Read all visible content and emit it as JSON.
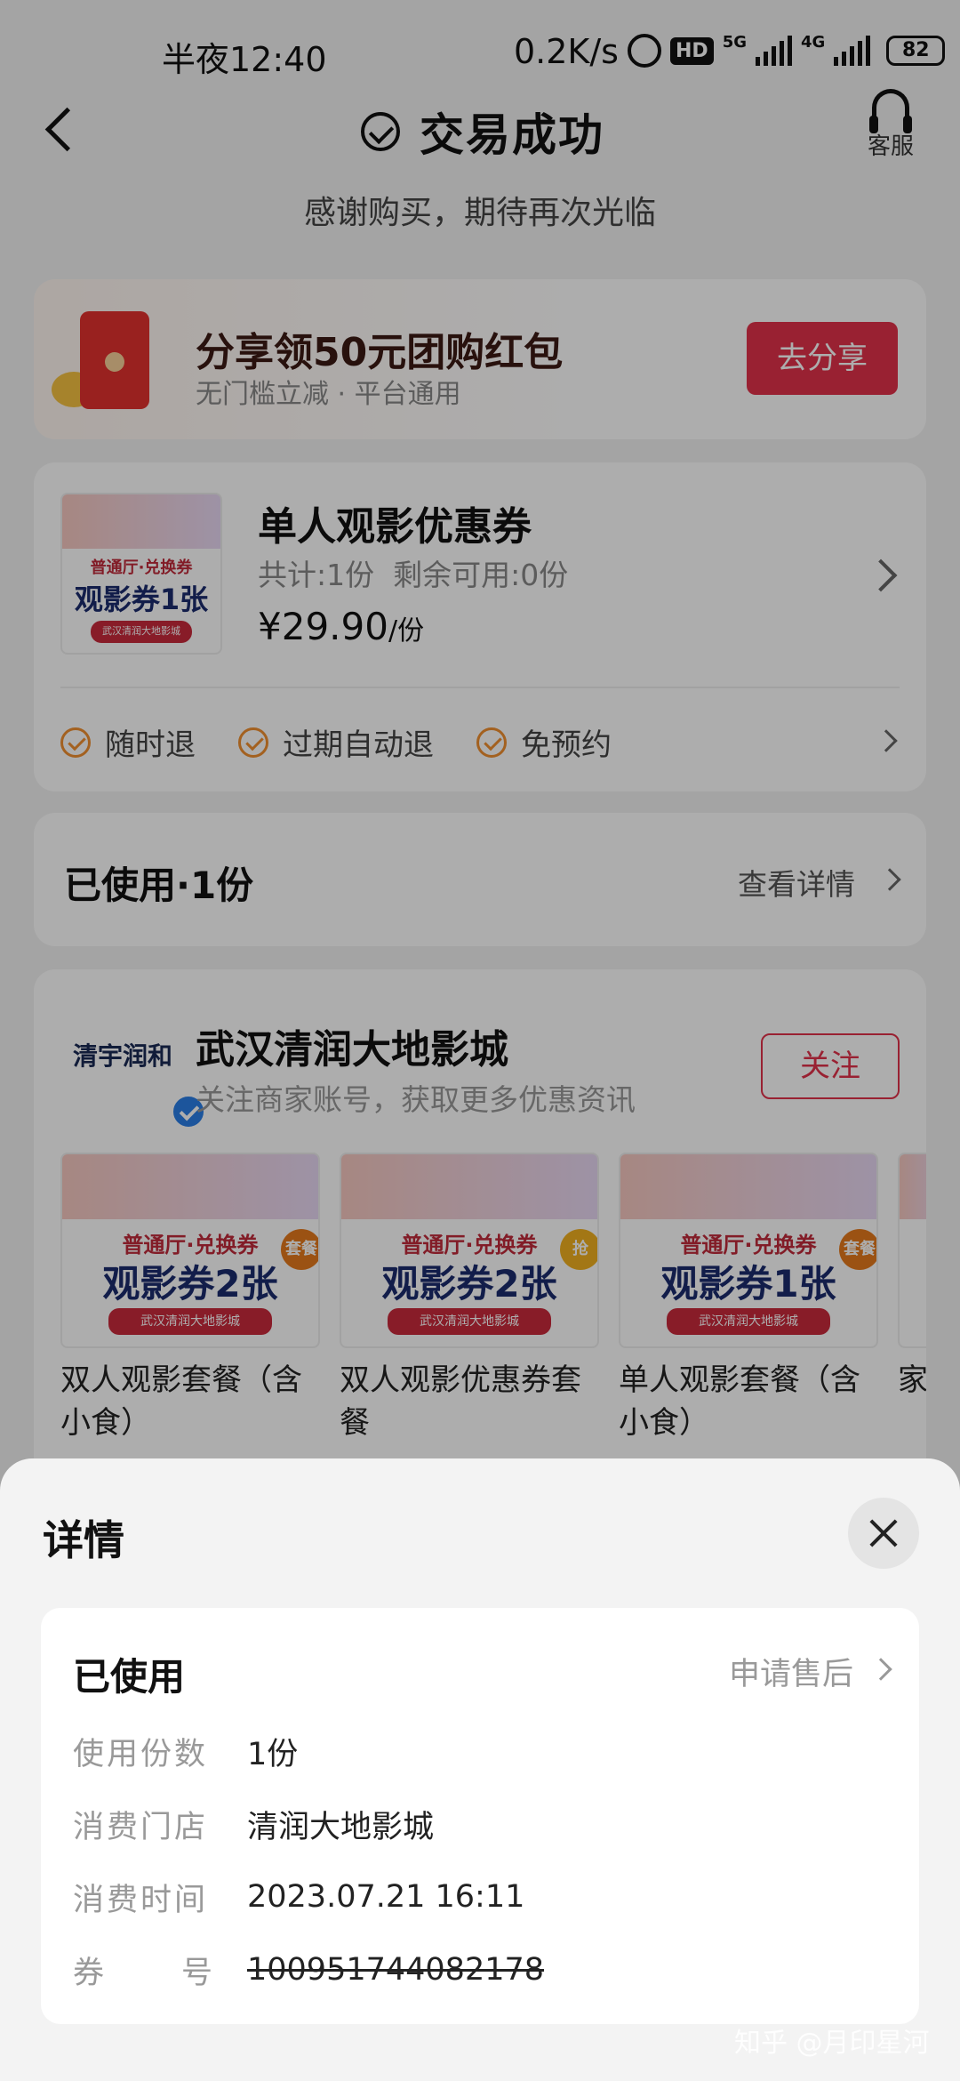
{
  "status_bar": {
    "time": "半夜12:40",
    "net_speed": "0.2K/s",
    "hd": "HD",
    "net1": "5G",
    "net2": "4G",
    "battery": "82"
  },
  "nav": {
    "title": "交易成功",
    "service_label": "客服"
  },
  "subtitle": "感谢购买，期待再次光临",
  "share": {
    "title": "分享领50元团购红包",
    "subtitle": "无门槛立减 · 平台通用",
    "button": "去分享"
  },
  "product": {
    "img_line1": "普通厅·兑换券",
    "img_line2": "观影券1张",
    "img_line3": "武汉清润大地影城",
    "name": "单人观影优惠券",
    "count": "共计:1份  剩余可用:0份",
    "price": "¥29.90",
    "price_unit": "/份",
    "tags": [
      "随时退",
      "过期自动退",
      "免预约"
    ]
  },
  "used": {
    "title": "已使用·1份",
    "link": "查看详情"
  },
  "shop": {
    "logo_text": "清宇润和",
    "name": "武汉清润大地影城",
    "subtitle": "关注商家账号，获取更多优惠资讯",
    "follow": "关注",
    "deals": [
      {
        "img_line1": "普通厅·兑换券",
        "img_line2": "观影券2张",
        "img_line3": "武汉清润大地影城",
        "badge": "套餐",
        "name": "双人观影套餐（含小食）"
      },
      {
        "img_line1": "普通厅·兑换券",
        "img_line2": "观影券2张",
        "img_line3": "武汉清润大地影城",
        "badge": "抢",
        "name": "双人观影优惠券套餐"
      },
      {
        "img_line1": "普通厅·兑换券",
        "img_line2": "观影券1张",
        "img_line3": "武汉清润大地影城",
        "badge": "套餐",
        "name": "单人观影套餐（含小食）"
      },
      {
        "img_line1": "",
        "img_line2": "",
        "img_line3": "",
        "badge": "",
        "name": "家"
      }
    ]
  },
  "sheet": {
    "title": "详情",
    "status": "已使用",
    "aftersale": "申请售后",
    "rows": [
      {
        "label": "使用份数",
        "value": "1份"
      },
      {
        "label": "消费门店",
        "value": "清润大地影城"
      },
      {
        "label": "消费时间",
        "value": "2023.07.21 16:11"
      },
      {
        "label_a": "券",
        "label_b": "号",
        "value": "100951744082178"
      }
    ]
  },
  "watermark": "知乎 @月印星河"
}
